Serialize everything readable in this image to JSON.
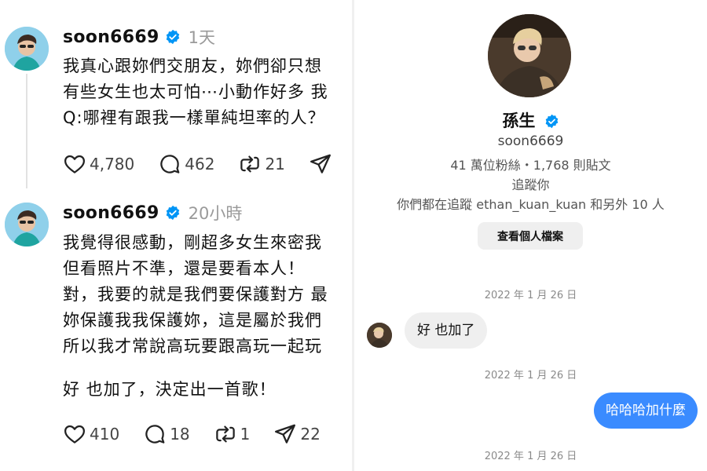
{
  "colors": {
    "verified_blue": "#0095f6",
    "outgoing_bubble": "#3a8bff",
    "incoming_bubble": "#efefef",
    "secondary_text": "#9a9a9a"
  },
  "posts": [
    {
      "username": "soon6669",
      "time": "1天",
      "lines": [
        "我真心跟妳們交朋友，妳們卻只想",
        "有些女生也太可怕⋯小動作好多 我",
        "Q:哪裡有跟我一樣單純坦率的人？"
      ],
      "likes": "4,780",
      "comments": "462",
      "reposts": "21",
      "shares": ""
    },
    {
      "username": "soon6669",
      "time": "20小時",
      "lines": [
        "我覺得很感動，剛超多女生來密我",
        "但看照片不準，還是要看本人！",
        "對，我要的就是我們要保護對方 最",
        "妳保護我我保護妳，這是屬於我們",
        "所以我才常說高玩要跟高玩一起玩"
      ],
      "closing_line": "好 也加了，決定出一首歌！",
      "likes": "410",
      "comments": "18",
      "reposts": "1",
      "shares": "22"
    }
  ],
  "profile": {
    "display_name": "孫生",
    "username": "soon6669",
    "stats": "41 萬位粉絲・1,768 則貼文",
    "follow_status": "追蹤你",
    "mutual": "你們都在追蹤 ethan_kuan_kuan 和另外 10 人",
    "view_profile_button": "查看個人檔案"
  },
  "messages": [
    {
      "date": "2022 年 1 月 26 日",
      "direction": "incoming",
      "text": "好 也加了"
    },
    {
      "date": "2022 年 1 月 26 日",
      "direction": "outgoing",
      "text": "哈哈哈加什麼"
    },
    {
      "date": "2022 年 1 月 26 日"
    }
  ],
  "icons": [
    "heart-icon",
    "comment-icon",
    "repost-icon",
    "share-icon",
    "verified-badge-icon"
  ]
}
